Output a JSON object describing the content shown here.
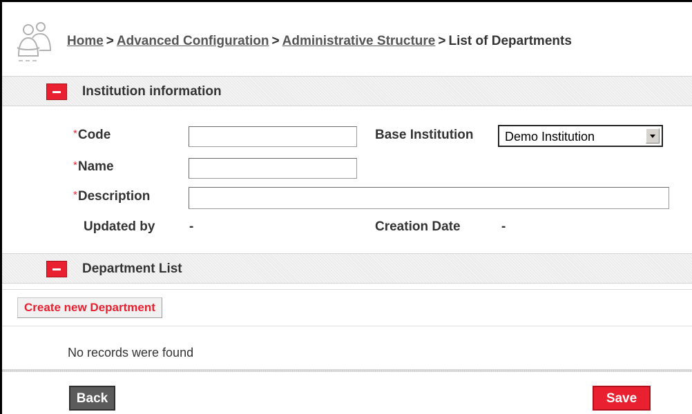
{
  "breadcrumb": {
    "home": "Home",
    "advanced_configuration": "Advanced Configuration",
    "administrative_structure": "Administrative Structure",
    "current": "List of Departments",
    "separator": ">"
  },
  "institution_section": {
    "title": "Institution information",
    "code_label": "Code",
    "code_value": "",
    "name_label": "Name",
    "name_value": "",
    "description_label": "Description",
    "description_value": "",
    "base_institution_label": "Base Institution",
    "base_institution_value": "Demo Institution",
    "updated_by_label": "Updated by",
    "updated_by_value": "-",
    "creation_date_label": "Creation Date",
    "creation_date_value": "-",
    "required_marker": "*"
  },
  "department_section": {
    "title": "Department List",
    "create_button_label": "Create new Department",
    "empty_message": "No records were found"
  },
  "footer": {
    "back_label": "Back",
    "save_label": "Save"
  },
  "colors": {
    "accent_red": "#e8202f",
    "section_bar": "#ececec",
    "back_button": "#5b5b5b"
  },
  "icons": {
    "logo": "users-group-icon",
    "collapse": "minus-icon",
    "dropdown": "chevron-down-icon"
  }
}
